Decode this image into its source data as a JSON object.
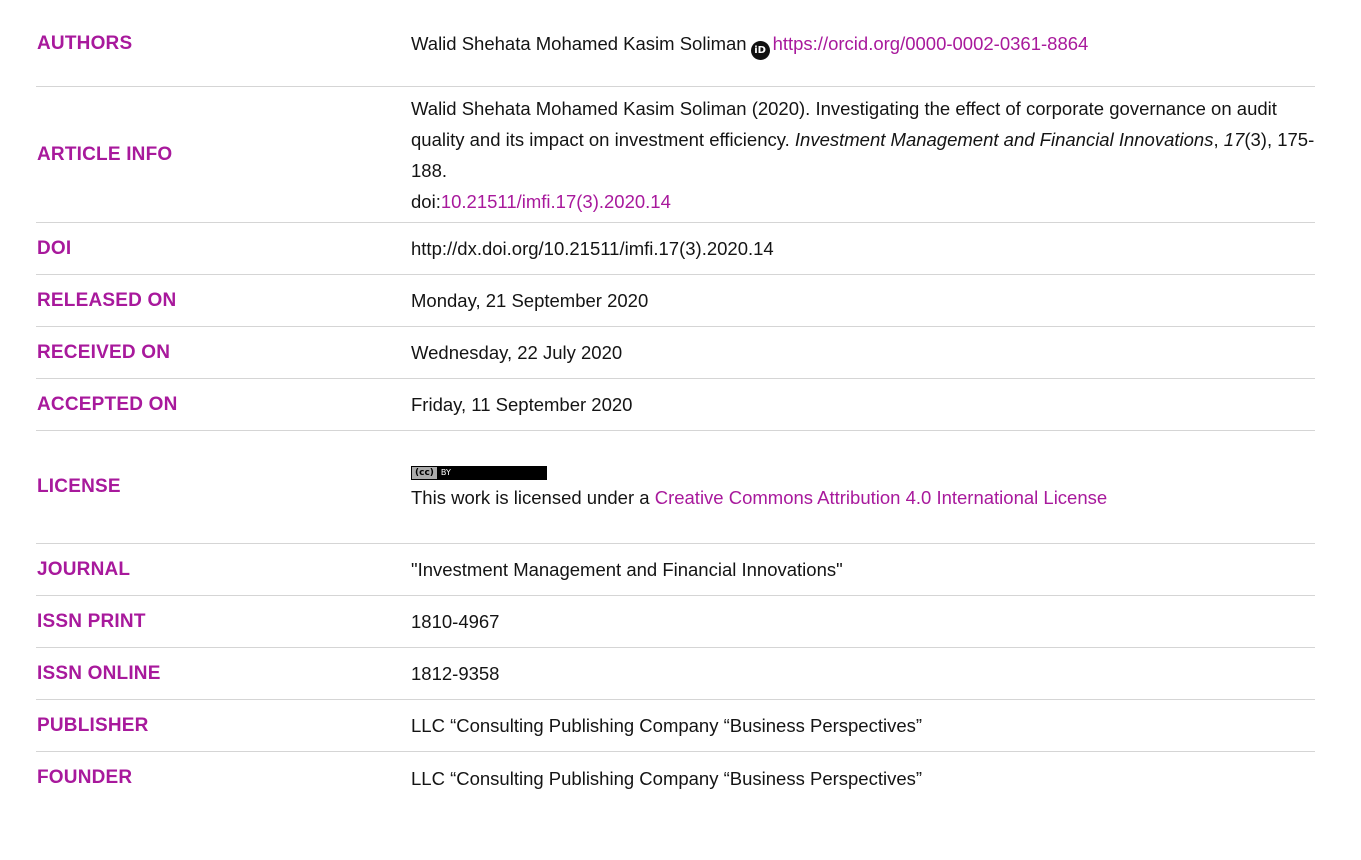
{
  "rows": {
    "authors": {
      "label": "AUTHORS",
      "name": "Walid Shehata Mohamed Kasim Soliman",
      "orcid_icon": "orcid-icon",
      "orcid_url": "https://orcid.org/0000-0002-0361-8864"
    },
    "article_info": {
      "label": "ARTICLE INFO",
      "citation_start": "Walid Shehata Mohamed Kasim Soliman (2020). Investigating the effect of corporate governance on audit quality and its impact on investment efficiency. ",
      "journal_italic": "Investment Management and Financial Innovations",
      "sep1": ", ",
      "volume_italic": "17",
      "issue_pages": "(3), 175-188.",
      "doi_prefix": "doi:",
      "doi_link": "10.21511/imfi.17(3).2020.14"
    },
    "doi": {
      "label": "DOI",
      "value": "http://dx.doi.org/10.21511/imfi.17(3).2020.14"
    },
    "released_on": {
      "label": "RELEASED ON",
      "value": "Monday, 21 September 2020"
    },
    "received_on": {
      "label": "RECEIVED ON",
      "value": "Wednesday, 22 July 2020"
    },
    "accepted_on": {
      "label": "ACCEPTED ON",
      "value": "Friday, 11 September 2020"
    },
    "license": {
      "label": "LICENSE",
      "badge_left": "(cc)",
      "badge_right": "BY",
      "text_prefix": "This work is licensed under a ",
      "link_text": "Creative Commons Attribution 4.0 International License"
    },
    "journal": {
      "label": "JOURNAL",
      "value": "\"Investment Management and Financial Innovations\""
    },
    "issn_print": {
      "label": "ISSN PRINT",
      "value": "1810-4967"
    },
    "issn_online": {
      "label": "ISSN ONLINE",
      "value": "1812-9358"
    },
    "publisher": {
      "label": "PUBLISHER",
      "value": "LLC “Consulting Publishing Company “Business Perspectives”"
    },
    "founder": {
      "label": "FOUNDER",
      "value": "LLC “Consulting Publishing Company “Business Perspectives”"
    }
  },
  "colors": {
    "label_accent": "#a8199c",
    "link": "#a8199c",
    "text": "#141414",
    "divider": "#d5d5d5"
  }
}
